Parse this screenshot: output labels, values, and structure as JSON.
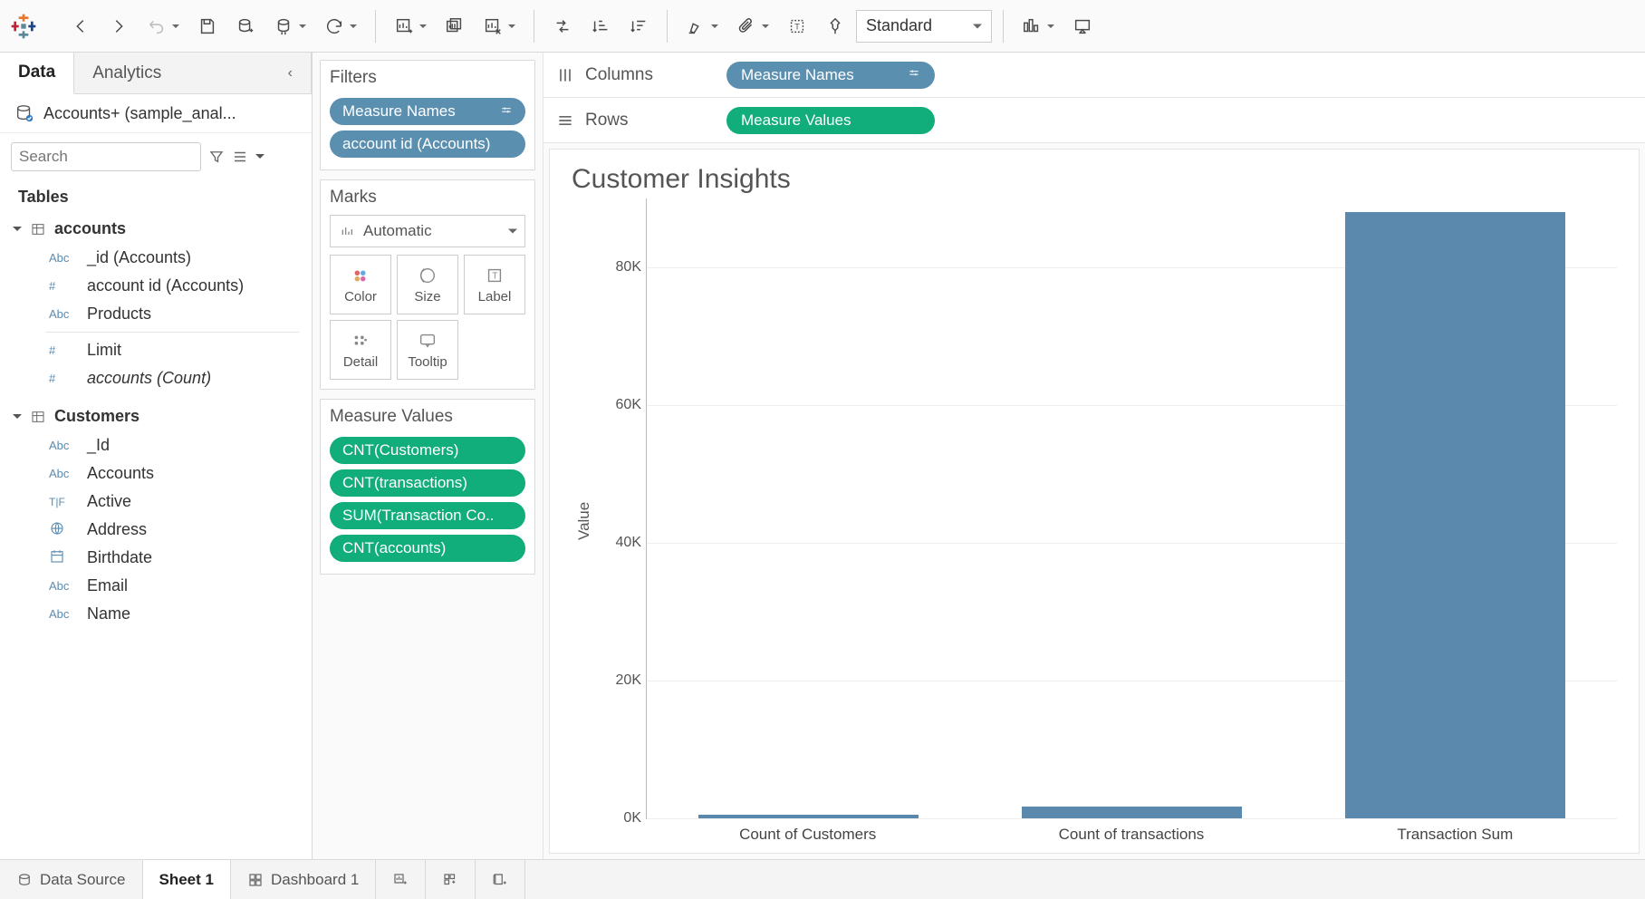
{
  "toolbar": {
    "fit_mode": "Standard"
  },
  "sidebar": {
    "tabs": {
      "data": "Data",
      "analytics": "Analytics"
    },
    "datasource": "Accounts+ (sample_anal...",
    "search_placeholder": "Search",
    "tables_label": "Tables",
    "tables": [
      {
        "name": "accounts",
        "fields": [
          {
            "type": "Abc",
            "name": "_id (Accounts)"
          },
          {
            "type": "#",
            "name": "account id (Accounts)"
          },
          {
            "type": "Abc",
            "name": "Products"
          }
        ],
        "measures": [
          {
            "type": "#",
            "name": "Limit"
          },
          {
            "type": "#",
            "name": "accounts (Count)",
            "italic": true
          }
        ]
      },
      {
        "name": "Customers",
        "fields": [
          {
            "type": "Abc",
            "name": "_Id"
          },
          {
            "type": "Abc",
            "name": "Accounts"
          },
          {
            "type": "T|F",
            "name": "Active"
          },
          {
            "type": "globe",
            "name": "Address"
          },
          {
            "type": "date",
            "name": "Birthdate"
          },
          {
            "type": "Abc",
            "name": "Email"
          },
          {
            "type": "Abc",
            "name": "Name"
          }
        ]
      }
    ]
  },
  "cards": {
    "filters_title": "Filters",
    "filters": [
      {
        "label": "Measure Names",
        "color": "blue",
        "icon": true
      },
      {
        "label": "account id (Accounts)",
        "color": "blue"
      }
    ],
    "marks_title": "Marks",
    "mark_type": "Automatic",
    "mark_cells": {
      "color": "Color",
      "size": "Size",
      "label": "Label",
      "detail": "Detail",
      "tooltip": "Tooltip"
    },
    "measure_values_title": "Measure Values",
    "measure_values": [
      "CNT(Customers)",
      "CNT(transactions)",
      "SUM(Transaction Co..",
      "CNT(accounts)"
    ]
  },
  "shelves": {
    "columns_label": "Columns",
    "columns_pill": "Measure Names",
    "rows_label": "Rows",
    "rows_pill": "Measure Values"
  },
  "viz": {
    "title": "Customer Insights",
    "ylabel": "Value"
  },
  "chart_data": {
    "type": "bar",
    "categories": [
      "Count of Customers",
      "Count of transactions",
      "Transaction Sum"
    ],
    "values": [
      500,
      1700,
      88000
    ],
    "title": "Customer Insights",
    "xlabel": "",
    "ylabel": "Value",
    "ylim": [
      0,
      90000
    ],
    "yticks": [
      0,
      20000,
      40000,
      60000,
      80000
    ],
    "ytick_labels": [
      "0K",
      "20K",
      "40K",
      "60K",
      "80K"
    ]
  },
  "bottom": {
    "datasource": "Data Source",
    "sheet": "Sheet 1",
    "dashboard": "Dashboard 1"
  }
}
